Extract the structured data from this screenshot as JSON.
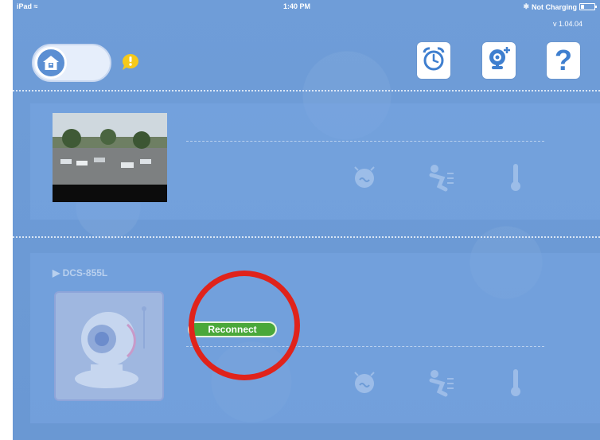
{
  "status_bar": {
    "carrier": "iPad",
    "time": "1:40 PM",
    "battery": "Not Charging"
  },
  "version": "v 1.04.04",
  "header": {
    "home_toggle_icon": "home-icon",
    "alert_icon": "exclamation-icon",
    "buttons": [
      {
        "icon": "alarm-clock-icon"
      },
      {
        "icon": "add-camera-icon"
      },
      {
        "icon": "help-icon",
        "label": "?"
      }
    ]
  },
  "cameras": [
    {
      "name": "",
      "sensors": [
        "sound-sensor-icon",
        "motion-sensor-icon",
        "temperature-sensor-icon"
      ]
    },
    {
      "name": "DCS-855L",
      "reconnect_label": "Reconnect",
      "sensors": [
        "sound-sensor-icon",
        "motion-sensor-icon",
        "temperature-sensor-icon"
      ]
    }
  ],
  "colors": {
    "background": "#6d9bd5",
    "reconnect": "#4aa83a",
    "highlight_circle": "#e0231b",
    "alert": "#f6c91a"
  }
}
